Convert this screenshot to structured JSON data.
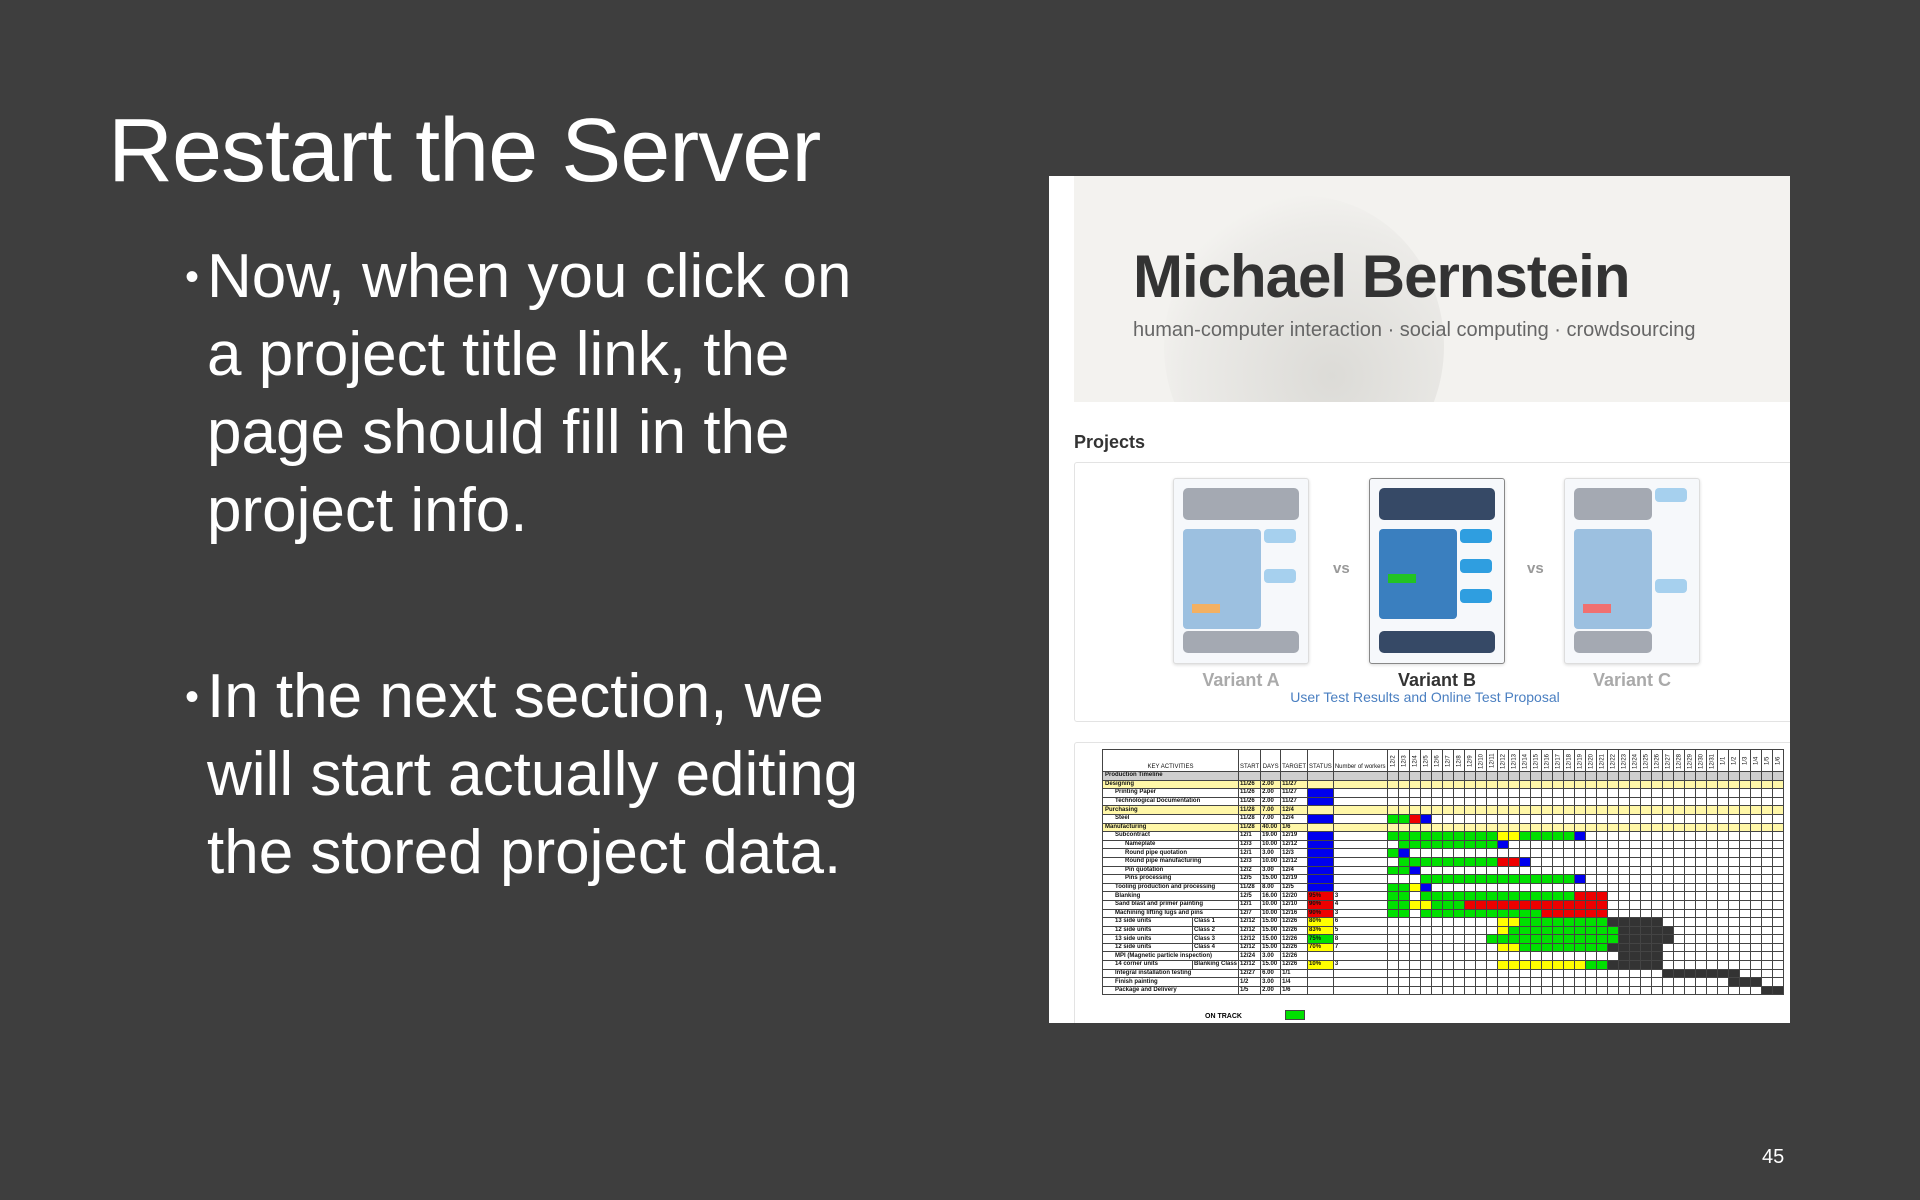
{
  "slide": {
    "title": "Restart the Server",
    "bullets": [
      "Now, when you click on a project title link, the page should fill in the project info.",
      "In the next section, we will start actually editing the stored project data."
    ],
    "page_number": "45"
  },
  "site": {
    "name": "Michael Bernstein",
    "tagline": "human-computer interaction · social computing · crowdsourcing",
    "projects_heading": "Projects",
    "variants": [
      {
        "label": "Variant A",
        "accent": "#f3b062"
      },
      {
        "label": "Variant B",
        "accent": "#22c322"
      },
      {
        "label": "Variant C",
        "accent": "#f07070"
      }
    ],
    "vs": "vs",
    "project_link": "User Test Results and Online Test Proposal"
  },
  "gantt": {
    "headers": {
      "activities": "KEY ACTIVITIES",
      "start": "START",
      "days": "DAYS",
      "target": "TARGET",
      "status": "STATUS",
      "workers": "Number of workers",
      "days_row": "Days"
    },
    "dates": [
      "12/2",
      "12/3",
      "12/4",
      "12/5",
      "12/6",
      "12/7",
      "12/8",
      "12/9",
      "12/10",
      "12/11",
      "12/12",
      "12/13",
      "12/14",
      "12/15",
      "12/16",
      "12/17",
      "12/18",
      "12/19",
      "12/20",
      "12/21",
      "12/22",
      "12/23",
      "12/24",
      "12/25",
      "12/26",
      "12/27",
      "12/28",
      "12/29",
      "12/30",
      "12/31",
      "1/1",
      "1/2",
      "1/3",
      "1/4",
      "1/5",
      "1/6"
    ],
    "colors": {
      "g": "#00e000",
      "y": "#ffff00",
      "r": "#ee0000",
      "b": "#0000ee",
      "k": "#333333",
      ".": "#ffffff"
    },
    "rows": [
      {
        "name": "Production Timeline",
        "type": "title"
      },
      {
        "name": "Designing",
        "type": "section",
        "start": "11/26",
        "days": "2.00",
        "target": "11/27"
      },
      {
        "name": "Printing Paper",
        "indent": 1,
        "start": "11/26",
        "days": "2.00",
        "target": "11/27",
        "status": "b"
      },
      {
        "name": "Technological Documentation",
        "indent": 1,
        "start": "11/26",
        "days": "2.00",
        "target": "11/27",
        "status": "b"
      },
      {
        "name": "Purchasing",
        "type": "section",
        "start": "11/28",
        "days": "7.00",
        "target": "12/4"
      },
      {
        "name": "Steel",
        "indent": 1,
        "start": "11/28",
        "days": "7.00",
        "target": "12/4",
        "status": "b",
        "bar": "ggrb"
      },
      {
        "name": "Manufacturing",
        "type": "section",
        "start": "11/28",
        "days": "40.00",
        "target": "1/6"
      },
      {
        "name": "Subcontract",
        "indent": 1,
        "start": "12/1",
        "days": "19.00",
        "target": "12/19",
        "status": "b",
        "bar": "ggggggggggyygggggb"
      },
      {
        "name": "Nameplate",
        "indent": 2,
        "start": "12/3",
        "days": "10.00",
        "target": "12/12",
        "status": "b",
        "bar": ".gggggggggb"
      },
      {
        "name": "Round pipe quotation",
        "indent": 2,
        "start": "12/1",
        "days": "3.00",
        "target": "12/3",
        "status": "b",
        "bar": "gb"
      },
      {
        "name": "Round pipe manufacturing",
        "indent": 2,
        "start": "12/3",
        "days": "10.00",
        "target": "12/12",
        "status": "b",
        "bar": ".gggggggggrrb"
      },
      {
        "name": "Pin quotation",
        "indent": 2,
        "start": "12/2",
        "days": "3.00",
        "target": "12/4",
        "status": "b",
        "bar": "ggb"
      },
      {
        "name": "Pins processing",
        "indent": 2,
        "start": "12/5",
        "days": "15.00",
        "target": "12/19",
        "status": "b",
        "bar": "...ggggggggggggggb"
      },
      {
        "name": "Tooling production and processing",
        "indent": 1,
        "start": "11/28",
        "days": "8.00",
        "target": "12/5",
        "status": "b",
        "bar": "ggyb"
      },
      {
        "name": "Blanking",
        "indent": 1,
        "start": "12/5",
        "days": "16.00",
        "target": "12/20",
        "status": "r",
        "pct": "95%",
        "workers": "3",
        "bar": "gg.ggggggggggggggrrr"
      },
      {
        "name": "Sand blast and primer painting",
        "indent": 1,
        "start": "12/1",
        "days": "10.00",
        "target": "12/10",
        "status": "r",
        "pct": "90%",
        "workers": "4",
        "bar": "ggyygggrrrrrrrrrrrrr"
      },
      {
        "name": "Machining lifting lugs and pins",
        "indent": 1,
        "start": "12/7",
        "days": "10.00",
        "target": "12/16",
        "status": "r",
        "pct": "90%",
        "workers": "3",
        "bar": "gg.gggggggggggrrrrrr"
      },
      {
        "name": "13 side units",
        "class": "Class 1",
        "indent": 1,
        "start": "12/12",
        "days": "15.00",
        "target": "12/26",
        "status": "y",
        "pct": "80%",
        "workers": "6",
        "bar": "..........yyggggggggkkkkk"
      },
      {
        "name": "12 side units",
        "class": "Class 2",
        "indent": 1,
        "start": "12/12",
        "days": "15.00",
        "target": "12/26",
        "status": "y",
        "pct": "83%",
        "workers": "5",
        "bar": "..........yggggggggggkkkkk"
      },
      {
        "name": "13 side units",
        "class": "Class 3",
        "indent": 1,
        "start": "12/12",
        "days": "15.00",
        "target": "12/26",
        "status": "g",
        "pct": "75%",
        "workers": "8",
        "bar": ".........ggggggggggggkkkkk"
      },
      {
        "name": "12 side units",
        "class": "Class 4",
        "indent": 1,
        "start": "12/12",
        "days": "15.00",
        "target": "12/26",
        "status": "y",
        "pct": "70%",
        "workers": "7",
        "bar": "..........yyggggggggkkkkk"
      },
      {
        "name": "MPI (Magnetic particle inspection)",
        "indent": 1,
        "start": "12/24",
        "days": "3.00",
        "target": "12/26",
        "bar": ".....................kkkk"
      },
      {
        "name": "14 corner units",
        "class": "Blanking Class",
        "indent": 1,
        "start": "12/12",
        "days": "15.00",
        "target": "12/26",
        "status": "y",
        "pct": "10%",
        "workers": "3",
        "bar": "..........yyyyyyyyggkkkkk"
      },
      {
        "name": "Integral installation testing",
        "indent": 1,
        "start": "12/27",
        "days": "6.00",
        "target": "1/1",
        "bar": ".........................kkkkkkk"
      },
      {
        "name": "Finish painting",
        "indent": 1,
        "start": "1/2",
        "days": "3.00",
        "target": "1/4",
        "bar": "...............................kkk"
      },
      {
        "name": "Package and Delivery",
        "indent": 1,
        "start": "1/5",
        "days": "2.00",
        "target": "1/6",
        "bar": "..................................kk"
      }
    ],
    "legend": "ON TRACK"
  }
}
